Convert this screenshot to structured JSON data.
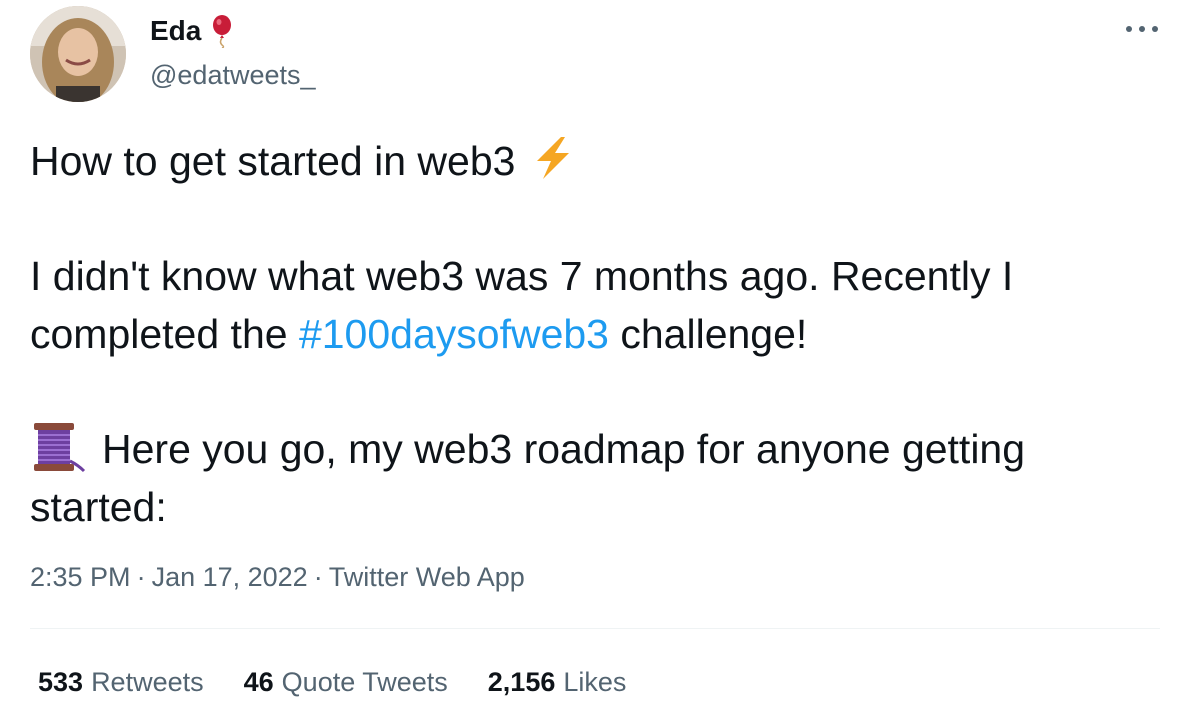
{
  "author": {
    "display_name": "Eda",
    "handle": "@edatweets_",
    "name_emoji": "balloon-icon"
  },
  "tweet": {
    "line1": "How to get started in web3",
    "line2": "I didn't know what web3 was 7 months ago. Recently I",
    "line3_before": "completed the ",
    "hashtag": "#100daysofweb3",
    "line3_after": " challenge!",
    "line4": "Here you go, my web3 roadmap for anyone getting",
    "line5": "started:",
    "emojis": [
      "bolt-icon",
      "thread-icon"
    ]
  },
  "meta": {
    "time": "2:35 PM",
    "separator": "·",
    "date": "Jan 17, 2022",
    "source": "Twitter Web App"
  },
  "stats": [
    {
      "count": "533",
      "label": "Retweets"
    },
    {
      "count": "46",
      "label": "Quote Tweets"
    },
    {
      "count": "2,156",
      "label": "Likes"
    }
  ],
  "colors": {
    "text": "#0f1419",
    "secondary": "#536471",
    "link": "#1d9bf0",
    "divider": "#eff3f4"
  }
}
